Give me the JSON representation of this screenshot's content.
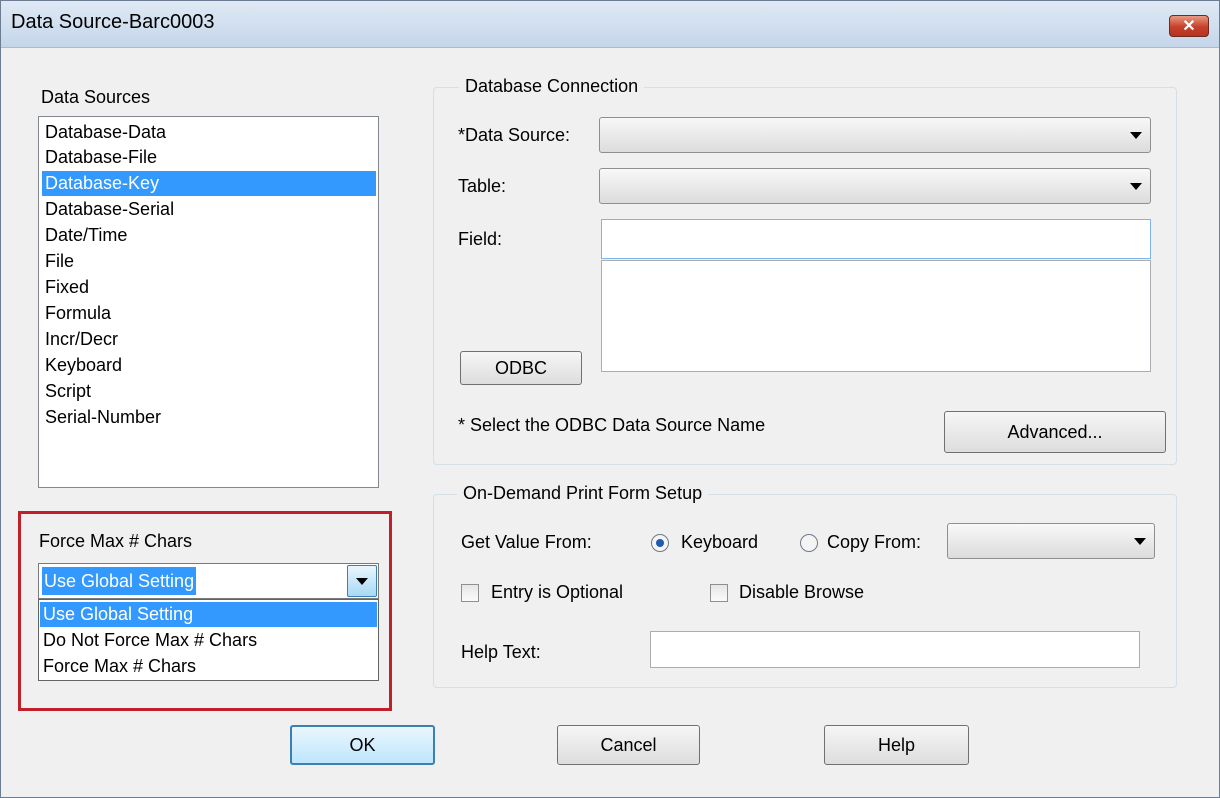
{
  "window": {
    "title": "Data Source-Barc0003",
    "close_glyph": "✕"
  },
  "data_sources": {
    "label": "Data Sources",
    "items": [
      {
        "label": "Database-Data"
      },
      {
        "label": "Database-File"
      },
      {
        "label": "Database-Key",
        "selected": true
      },
      {
        "label": "Database-Serial"
      },
      {
        "label": "Date/Time"
      },
      {
        "label": "File"
      },
      {
        "label": "Fixed"
      },
      {
        "label": "Formula"
      },
      {
        "label": "Incr/Decr"
      },
      {
        "label": "Keyboard"
      },
      {
        "label": "Script"
      },
      {
        "label": "Serial-Number"
      }
    ]
  },
  "force_max": {
    "label": "Force Max # Chars",
    "value": "Use Global Setting",
    "options": [
      "Use Global Setting",
      "Do Not Force Max # Chars",
      "Force Max # Chars"
    ]
  },
  "database_connection": {
    "title": "Database  Connection",
    "data_source_label": "*Data Source:",
    "data_source_value": "",
    "table_label": "Table:",
    "table_value": "",
    "field_label": "Field:",
    "field_value": "",
    "odbc_button": "ODBC",
    "hint": "* Select the ODBC Data Source Name",
    "advanced_button": "Advanced..."
  },
  "on_demand": {
    "title": "On-Demand Print Form Setup",
    "get_value_label": "Get Value From:",
    "radio_keyboard": "Keyboard",
    "radio_copy_from": "Copy From:",
    "selected_radio": "Keyboard",
    "copy_from_value": "",
    "entry_optional": "Entry is Optional",
    "entry_optional_checked": false,
    "disable_browse": "Disable Browse",
    "disable_browse_checked": false,
    "help_text_label": "Help Text:",
    "help_text_value": ""
  },
  "buttons": {
    "ok": "OK",
    "cancel": "Cancel",
    "help": "Help"
  },
  "colors": {
    "selection": "#3399ff",
    "highlight_border": "#c0202c",
    "title_bar": "#c5d6ea",
    "close_button": "#c7402a"
  }
}
